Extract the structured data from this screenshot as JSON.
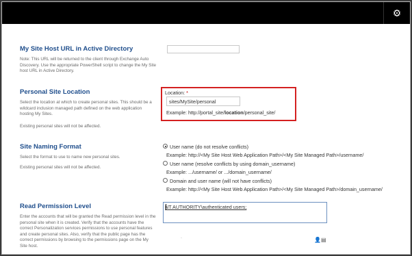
{
  "header": {
    "settings_icon": "gear-icon"
  },
  "sections": {
    "url": {
      "title": "My Site Host URL in Active Directory",
      "desc": "Note: This URL will be returned to the client through Exchange Auto Discovery. Use the appropriate PowerShell script to change the My Site host URL in Active Directory."
    },
    "location": {
      "title": "Personal Site Location",
      "desc": "Select the location at which to create personal sites. This should be a wildcard inclusion managed path defined on the web application hosting My Sites.",
      "desc2": "Existing personal sites will not be affected.",
      "label": "Location:",
      "required": "*",
      "value": "sites/MySite/personal",
      "example_prefix": "Example: http://portal_site/",
      "example_bold": "location",
      "example_suffix": "/personal_site/"
    },
    "naming": {
      "title": "Site Naming Format",
      "desc": "Select the format to use to name new personal sites.",
      "desc2": "Existing personal sites will not be affected.",
      "options": [
        {
          "label": "User name (do not resolve conflicts)",
          "example": "Example: http://<My Site Host Web Application Path>/<My Site Managed Path>/username/",
          "selected": true
        },
        {
          "label": "User name (resolve conflicts by using domain_username)",
          "example": "Example: .../username/ or .../domain_username/",
          "selected": false
        },
        {
          "label": "Domain and user name (will not have conflicts)",
          "example": "Example: http://<My Site Host Web Application Path>/<My Site Managed Path>/domain_username/",
          "selected": false
        }
      ]
    },
    "permission": {
      "title": "Read Permission Level",
      "desc": "Enter the accounts that will be granted the Read permission level in the personal site when it is created. Verify that the accounts have the correct Personalization services permissions to use personal features and create personal sites. Also, verify that the public page has the correct permissions by browsing to the permissions page on the My Site host.",
      "value": "NT AUTHORITY\\authenticated users;",
      "check_names_icon": "check-names-icon",
      "browse_icon": "address-book-icon",
      "dot": "."
    }
  }
}
